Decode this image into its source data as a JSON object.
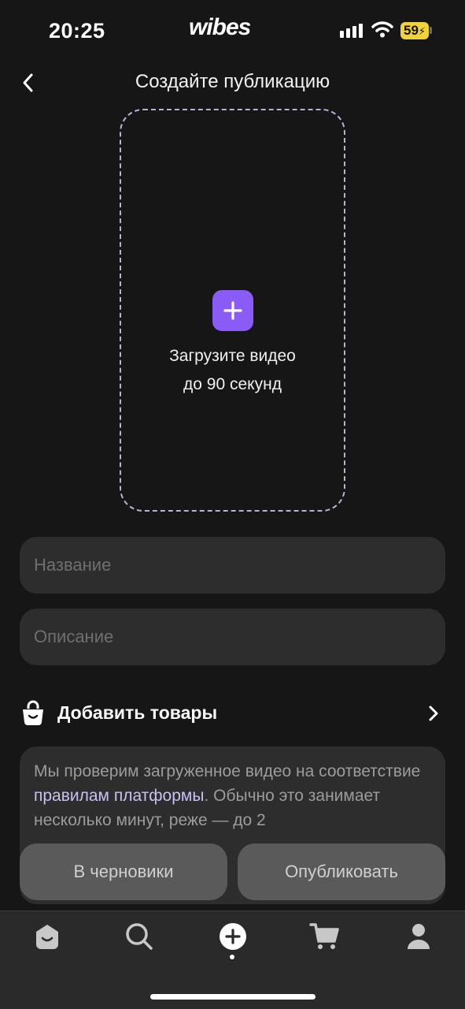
{
  "status_bar": {
    "time": "20:25",
    "brand": "wibes",
    "battery": "59"
  },
  "header": {
    "title": "Создайте публикацию"
  },
  "upload": {
    "line1": "Загрузите видео",
    "line2": "до 90 секунд"
  },
  "form": {
    "name_placeholder": "Название",
    "description_placeholder": "Описание"
  },
  "products": {
    "label": "Добавить товары"
  },
  "info": {
    "text_before": "Мы проверим загруженное видео на соответствие ",
    "link": "правилам платформы",
    "text_after": ". Обычно это занимает несколько минут, реже — до 2"
  },
  "actions": {
    "draft": "В черновики",
    "publish": "Опубликовать"
  },
  "colors": {
    "accent": "#8a5cf5",
    "background": "#161616",
    "field": "#2d2d2d",
    "battery": "#f2d23a"
  },
  "tabs": [
    {
      "icon": "home-icon"
    },
    {
      "icon": "search-icon"
    },
    {
      "icon": "create-icon",
      "active": true
    },
    {
      "icon": "cart-icon"
    },
    {
      "icon": "profile-icon"
    }
  ]
}
